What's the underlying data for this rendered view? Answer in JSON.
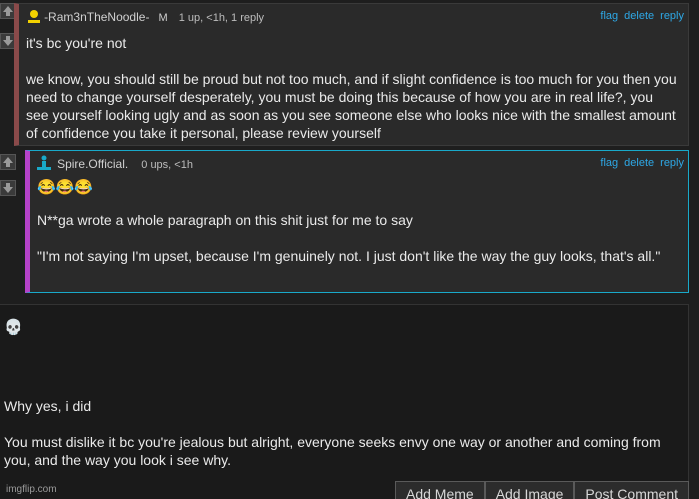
{
  "comment1": {
    "username": "-Ram3nTheNoodle-",
    "badge": "M",
    "meta": "1 up, <1h, 1 reply",
    "actions": {
      "flag": "flag",
      "delete": "delete",
      "reply": "reply"
    },
    "paragraphs": [
      "it's bc you're not",
      "we know, you should still be proud but not too much, and if slight confidence is too much for you then you need to change yourself desperately, you must be doing this because of how you are in real life?, you see yourself looking ugly and as soon as you see someone else who looks nice with the smallest amount of confidence you take it personal, please review yourself"
    ]
  },
  "comment2": {
    "username": "Spire.Official.",
    "meta": "0 ups, <1h",
    "actions": {
      "flag": "flag",
      "delete": "delete",
      "reply": "reply"
    },
    "emojis": "😂😂😂",
    "paragraphs": [
      "N**ga wrote a whole paragraph on this shit just for me to say",
      "\"I'm not saying I'm upset, because I'm genuinely not. I just don't like the way the guy looks, that's all.\""
    ]
  },
  "reply_draft": {
    "emoji": "💀",
    "paragraphs": [
      "Why yes, i did",
      "You must dislike it bc you're jealous but alright, everyone seeks envy one way or another and coming from you, and the way you look i see why."
    ]
  },
  "buttons": {
    "add_meme": "Add Meme",
    "add_image": "Add Image",
    "post_comment": "Post Comment"
  },
  "credit": "imgflip.com",
  "colors": {
    "accent_link": "#2ea8e6",
    "op_bar": "#8a4a4a",
    "reply_bar": "#b542c9",
    "reply_border": "#19a9c9",
    "user_icon_yellow": "#f2d100",
    "user_icon_cyan": "#19a9c9"
  }
}
